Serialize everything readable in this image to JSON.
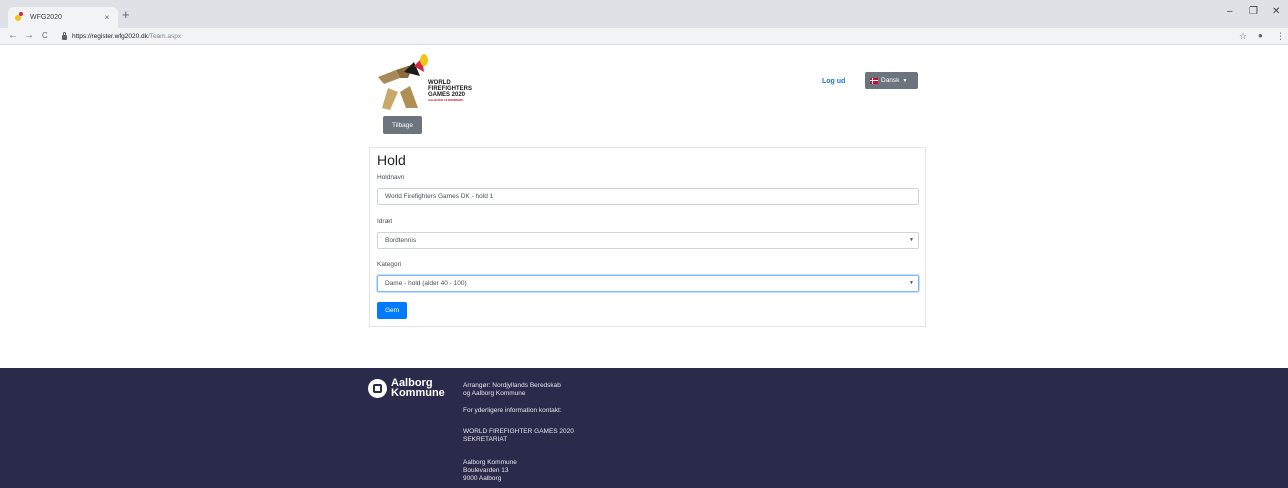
{
  "browser": {
    "tab_title": "WFG2020",
    "tab_close": "×",
    "new_tab": "+",
    "url_host": "https://register.wfg2020.dk",
    "url_path": "/Team.aspx",
    "back": "←",
    "forward": "→",
    "reload": "C",
    "star": "☆",
    "account": "●",
    "menu": "⋮",
    "min": "–",
    "restore": "❐",
    "close": "✕"
  },
  "header": {
    "logo_text_1": "WORLD",
    "logo_text_2": "FIREFIGHTERS",
    "logo_text_3": "GAMES 2020",
    "logo_sub": "AALBORG 19 DENMARK",
    "logout": "Log ud",
    "language": "Dansk",
    "back_button": "Tilbage"
  },
  "form": {
    "title": "Hold",
    "team_name_label": "Holdnavn",
    "team_name_value": "World Firefighters Games DK - hold 1",
    "sport_label": "Idræt",
    "sport_value": "Bordtennis",
    "category_label": "Kategori",
    "category_value": "Dame - hold (alder 40 - 100)",
    "save_button": "Gem"
  },
  "footer": {
    "brand_line1": "Aalborg",
    "brand_line2": "Kommune",
    "organizer1": "Arrangør: Nordjyllands Beredskab",
    "organizer2": "og Aalborg Kommune",
    "more_info": "For yderligere information kontakt:",
    "secretariat1": "WORLD FIREFIGHTER GAMES 2020",
    "secretariat2": "SEKRETARIAT",
    "address1": "Aalborg Kommune",
    "address2": "Boulevarden 13",
    "address3": "9000 Aalborg"
  },
  "colors": {
    "primary": "#007bff",
    "secondary": "#6c757d",
    "footer_bg": "#2a2a4a",
    "link": "#1a73e8"
  },
  "icons": [
    "wfg-favicon-icon",
    "lock-icon",
    "star-icon",
    "account-icon",
    "denmark-flag-icon",
    "aalborg-seal-icon"
  ]
}
